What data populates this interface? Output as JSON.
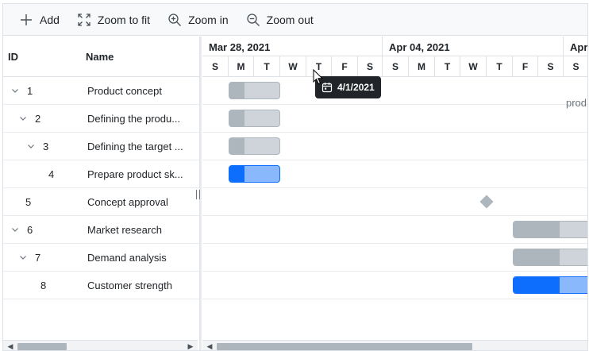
{
  "toolbar": {
    "add": "Add",
    "zoom_to_fit": "Zoom to fit",
    "zoom_in": "Zoom in",
    "zoom_out": "Zoom out"
  },
  "grid": {
    "columns": {
      "id": "ID",
      "name": "Name"
    },
    "rows": [
      {
        "id": "1",
        "name": "Product concept",
        "expandable": true
      },
      {
        "id": "2",
        "name": "Defining the produ...",
        "expandable": true
      },
      {
        "id": "3",
        "name": "Defining the target ...",
        "expandable": true
      },
      {
        "id": "4",
        "name": "Prepare product sk...",
        "expandable": false
      },
      {
        "id": "5",
        "name": "Concept approval",
        "expandable": false
      },
      {
        "id": "6",
        "name": "Market research",
        "expandable": true
      },
      {
        "id": "7",
        "name": "Demand analysis",
        "expandable": true
      },
      {
        "id": "8",
        "name": "Customer strength",
        "expandable": false
      }
    ]
  },
  "timeline": {
    "weeks": [
      "Mar 28, 2021",
      "Apr 04, 2021",
      "Apr"
    ],
    "days": [
      "S",
      "M",
      "T",
      "W",
      "T",
      "F",
      "S",
      "S",
      "M",
      "T",
      "W",
      "T",
      "F",
      "S",
      "S"
    ]
  },
  "chart": {
    "truncated_label": "prod",
    "tooltip": "4/1/2021"
  },
  "colors": {
    "parent_bar": "#ced4da",
    "parent_progress": "#adb5bd",
    "child_bar": "#8ab8fc",
    "child_progress": "#0d6efd",
    "tooltip_bg": "#212529"
  },
  "icons": {
    "add": "plus-icon",
    "zoom_to_fit": "expand-icon",
    "zoom_in": "zoom-in-icon",
    "zoom_out": "zoom-out-icon",
    "expand": "chevron-down-icon",
    "tooltip": "calendar-icon"
  }
}
